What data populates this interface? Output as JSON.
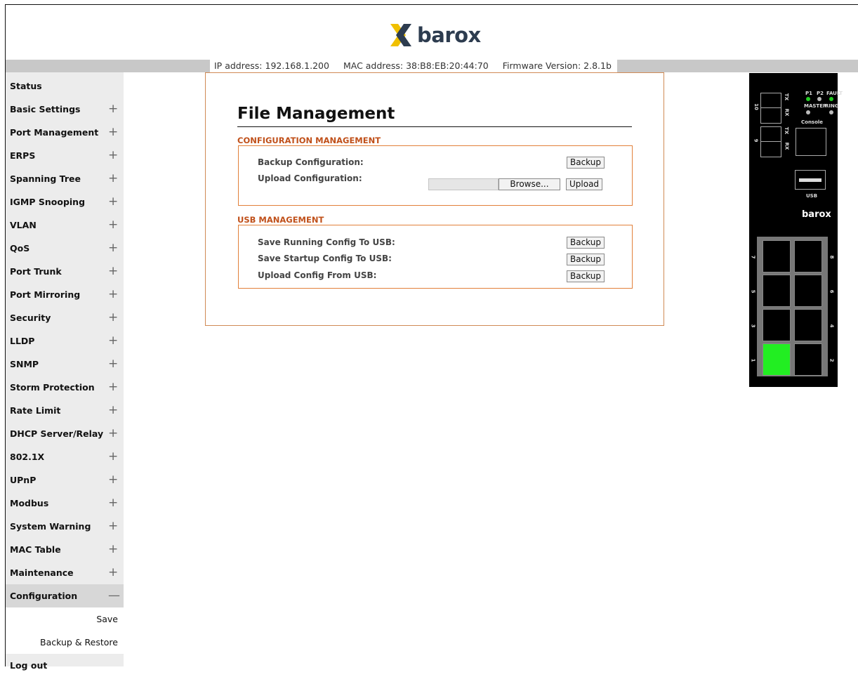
{
  "brand": {
    "name": "barox",
    "mark_color": "#f0c000",
    "text_color": "#2d3c4f"
  },
  "info": {
    "ip": "IP address: 192.168.1.200",
    "mac": "MAC address: 38:B8:EB:20:44:70",
    "firmware": "Firmware Version: 2.8.1b"
  },
  "sidebar": {
    "items": [
      {
        "label": "Status",
        "expandable": false
      },
      {
        "label": "Basic Settings",
        "expandable": true
      },
      {
        "label": "Port Management",
        "expandable": true
      },
      {
        "label": "ERPS",
        "expandable": true
      },
      {
        "label": "Spanning Tree",
        "expandable": true
      },
      {
        "label": "IGMP Snooping",
        "expandable": true
      },
      {
        "label": "VLAN",
        "expandable": true
      },
      {
        "label": "QoS",
        "expandable": true
      },
      {
        "label": "Port Trunk",
        "expandable": true
      },
      {
        "label": "Port Mirroring",
        "expandable": true
      },
      {
        "label": "Security",
        "expandable": true
      },
      {
        "label": "LLDP",
        "expandable": true
      },
      {
        "label": "SNMP",
        "expandable": true
      },
      {
        "label": "Storm Protection",
        "expandable": true
      },
      {
        "label": "Rate Limit",
        "expandable": true
      },
      {
        "label": "DHCP Server/Relay",
        "expandable": true
      },
      {
        "label": "802.1X",
        "expandable": true
      },
      {
        "label": "UPnP",
        "expandable": true
      },
      {
        "label": "Modbus",
        "expandable": true
      },
      {
        "label": "System Warning",
        "expandable": true
      },
      {
        "label": "MAC Table",
        "expandable": true
      },
      {
        "label": "Maintenance",
        "expandable": true
      }
    ],
    "configuration": {
      "label": "Configuration",
      "toggle": "—",
      "expanded": true,
      "subitems": [
        "Save",
        "Backup & Restore"
      ]
    },
    "logout": "Log out",
    "plus": "+"
  },
  "main": {
    "title": "File Management",
    "config_section": {
      "heading": "CONFIGURATION MANAGEMENT",
      "backup_label": "Backup Configuration:",
      "backup_button": "Backup",
      "upload_label": "Upload Configuration:",
      "browse_button": "Browse...",
      "upload_button": "Upload"
    },
    "usb_section": {
      "heading": "USB MANAGEMENT",
      "rows": [
        {
          "label": "Save Running Config To USB:",
          "button": "Backup"
        },
        {
          "label": "Save Startup Config To USB:",
          "button": "Backup"
        },
        {
          "label": "Upload Config From USB:",
          "button": "Backup"
        }
      ]
    }
  },
  "device": {
    "leds": {
      "p1": "P1",
      "p2": "P2",
      "fault": "FAULT",
      "master": "MASTER",
      "ring": "RING"
    },
    "console": "Console",
    "usb": "USB",
    "brand": "barox",
    "sfp_labels": {
      "tx": "TX",
      "rx": "RX",
      "port10": "10",
      "port9": "9"
    },
    "port_numbers": [
      "7",
      "8",
      "5",
      "6",
      "3",
      "4",
      "1",
      "2"
    ],
    "active_port": "1",
    "active_color": "#22ee22",
    "led_color": "#22cc22"
  }
}
